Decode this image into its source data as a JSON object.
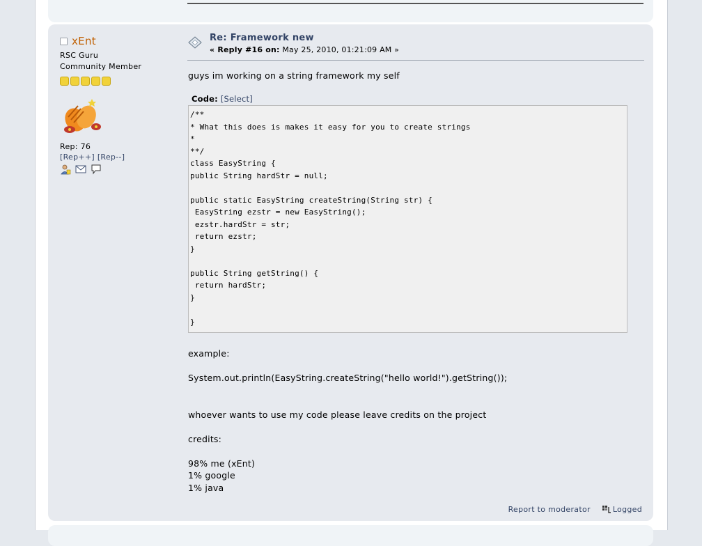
{
  "poster": {
    "name": "xEnt",
    "title": "RSC Guru",
    "group": "Community Member",
    "stars": 5,
    "rep": "Rep: 76",
    "rep_plus": "[Rep++]",
    "rep_minus": "[Rep--]"
  },
  "post": {
    "subject": "Re: Framework new",
    "reply_label": "« Reply #16 on:",
    "date": "May 25, 2010, 01:21:09 AM »",
    "intro": "guys im working on a string framework my self",
    "code_label": "Code:",
    "code_select": "[Select]",
    "code": "/**\n* What this does is makes it easy for you to create strings\n*\n**/\nclass EasyString {\npublic String hardStr = null;\n\npublic static EasyString createString(String str) {\n EasyString ezstr = new EasyString();\n ezstr.hardStr = str;\n return ezstr;\n}\n\npublic String getString() {\n return hardStr;\n}\n\n}",
    "example_label": "example:",
    "example_code": "System.out.println(EasyString.createString(\"hello world!\").getString());",
    "credits_note": "whoever wants to use my code please leave credits on the project",
    "credits_label": "credits:",
    "credit_1": "98% me (xEnt)",
    "credit_2": "1% google",
    "credit_3": "1% java"
  },
  "footer": {
    "report": "Report to moderator",
    "logged": "Logged"
  }
}
